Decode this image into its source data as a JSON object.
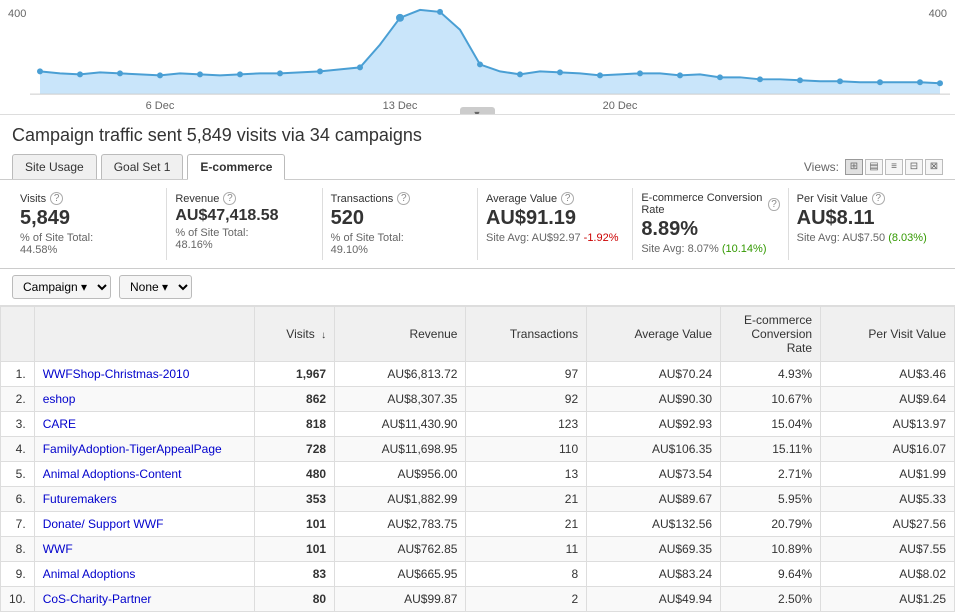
{
  "chart": {
    "y_label_left": "400",
    "y_label_right": "400",
    "x_labels": [
      "6 Dec",
      "13 Dec",
      "20 Dec"
    ]
  },
  "page_title": "Campaign traffic sent 5,849 visits via 34 campaigns",
  "tabs": [
    {
      "id": "site-usage",
      "label": "Site Usage"
    },
    {
      "id": "goal-set-1",
      "label": "Goal Set 1"
    },
    {
      "id": "ecommerce",
      "label": "E-commerce"
    }
  ],
  "views_label": "Views:",
  "stats": [
    {
      "label": "Visits",
      "value": "5,849",
      "sub1": "% of Site Total:",
      "sub2": "44.58%",
      "sub3": ""
    },
    {
      "label": "Revenue",
      "value": "AU$47,418.58",
      "sub1": "% of Site Total:",
      "sub2": "48.16%",
      "sub3": ""
    },
    {
      "label": "Transactions",
      "value": "520",
      "sub1": "% of Site Total:",
      "sub2": "49.10%",
      "sub3": ""
    },
    {
      "label": "Average Value",
      "value": "AU$91.19",
      "sub1": "Site Avg:",
      "sub2": "AU$92.97",
      "sub3": "-1.92%",
      "sub3_class": "negative"
    },
    {
      "label": "E-commerce Conversion Rate",
      "value": "8.89%",
      "sub1": "Site Avg: 8.07%",
      "sub2": "10.14%",
      "sub2_class": "positive",
      "sub3": ""
    },
    {
      "label": "Per Visit Value",
      "value": "AU$8.11",
      "sub1": "Site Avg:",
      "sub2": "AU$7.50",
      "sub3": "8.03%",
      "sub3_class": "positive"
    }
  ],
  "table": {
    "filter1_label": "Campaign",
    "filter2_label": "None",
    "columns": [
      "",
      "Visits",
      "Revenue",
      "Transactions",
      "Average Value",
      "E-commerce Conversion Rate",
      "Per Visit Value"
    ],
    "rows": [
      {
        "num": "1.",
        "name": "WWFShop-Christmas-2010",
        "visits": "1,967",
        "revenue": "AU$6,813.72",
        "transactions": "97",
        "avg_value": "AU$70.24",
        "conv_rate": "4.93%",
        "per_visit": "AU$3.46"
      },
      {
        "num": "2.",
        "name": "eshop",
        "visits": "862",
        "revenue": "AU$8,307.35",
        "transactions": "92",
        "avg_value": "AU$90.30",
        "conv_rate": "10.67%",
        "per_visit": "AU$9.64"
      },
      {
        "num": "3.",
        "name": "CARE",
        "visits": "818",
        "revenue": "AU$11,430.90",
        "transactions": "123",
        "avg_value": "AU$92.93",
        "conv_rate": "15.04%",
        "per_visit": "AU$13.97"
      },
      {
        "num": "4.",
        "name": "FamilyAdoption-TigerAppealPage",
        "visits": "728",
        "revenue": "AU$11,698.95",
        "transactions": "110",
        "avg_value": "AU$106.35",
        "conv_rate": "15.11%",
        "per_visit": "AU$16.07"
      },
      {
        "num": "5.",
        "name": "Animal Adoptions-Content",
        "visits": "480",
        "revenue": "AU$956.00",
        "transactions": "13",
        "avg_value": "AU$73.54",
        "conv_rate": "2.71%",
        "per_visit": "AU$1.99"
      },
      {
        "num": "6.",
        "name": "Futuremakers",
        "visits": "353",
        "revenue": "AU$1,882.99",
        "transactions": "21",
        "avg_value": "AU$89.67",
        "conv_rate": "5.95%",
        "per_visit": "AU$5.33"
      },
      {
        "num": "7.",
        "name": "Donate/ Support WWF",
        "visits": "101",
        "revenue": "AU$2,783.75",
        "transactions": "21",
        "avg_value": "AU$132.56",
        "conv_rate": "20.79%",
        "per_visit": "AU$27.56"
      },
      {
        "num": "8.",
        "name": "WWF",
        "visits": "101",
        "revenue": "AU$762.85",
        "transactions": "11",
        "avg_value": "AU$69.35",
        "conv_rate": "10.89%",
        "per_visit": "AU$7.55"
      },
      {
        "num": "9.",
        "name": "Animal Adoptions",
        "visits": "83",
        "revenue": "AU$665.95",
        "transactions": "8",
        "avg_value": "AU$83.24",
        "conv_rate": "9.64%",
        "per_visit": "AU$8.02"
      },
      {
        "num": "10.",
        "name": "CoS-Charity-Partner",
        "visits": "80",
        "revenue": "AU$99.87",
        "transactions": "2",
        "avg_value": "AU$49.94",
        "conv_rate": "2.50%",
        "per_visit": "AU$1.25"
      }
    ]
  }
}
